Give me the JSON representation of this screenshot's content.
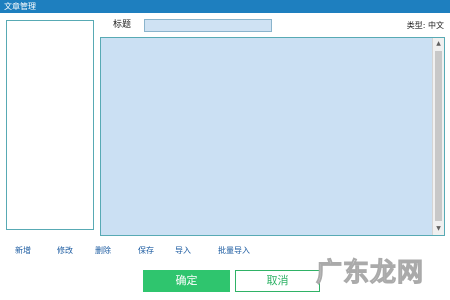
{
  "window": {
    "title": "文章管理"
  },
  "form": {
    "title_label": "标题",
    "title_value": "",
    "type_label": "类型:",
    "type_value": "中文",
    "content_value": ""
  },
  "scrollbar": {
    "up_glyph": "▲",
    "down_glyph": "▼"
  },
  "actions": {
    "add": "新增",
    "edit": "修改",
    "delete": "删除",
    "save": "保存",
    "import": "导入",
    "batch_import": "批量导入"
  },
  "buttons": {
    "confirm": "确定",
    "cancel": "取消"
  },
  "watermark": "广东龙网"
}
